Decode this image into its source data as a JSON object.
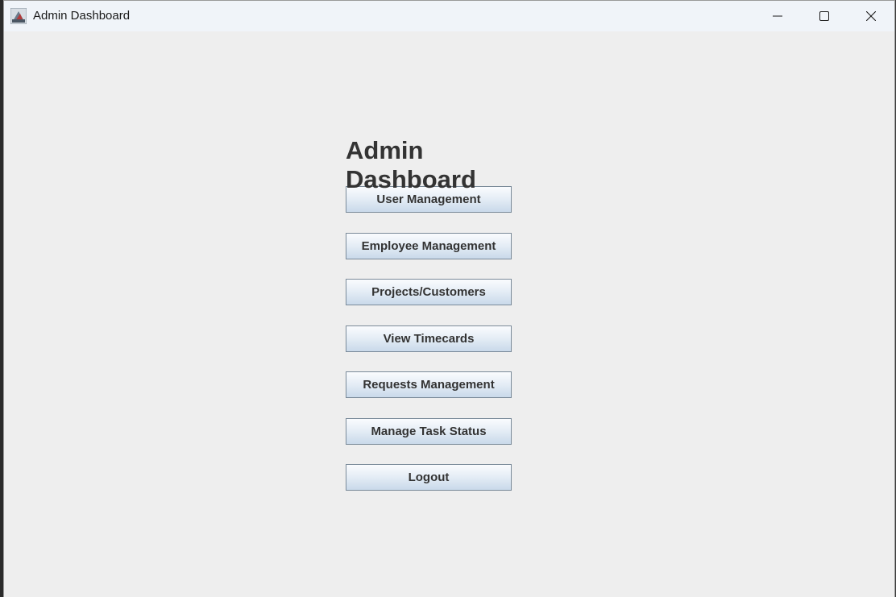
{
  "window": {
    "title": "Admin Dashboard",
    "app_icon": "java-app-icon"
  },
  "window_controls": {
    "minimize_icon": "minimize-icon",
    "maximize_icon": "maximize-icon",
    "close_icon": "close-icon"
  },
  "main": {
    "heading": "Admin Dashboard",
    "buttons": [
      {
        "label": "User Management"
      },
      {
        "label": "Employee Management"
      },
      {
        "label": "Projects/Customers"
      },
      {
        "label": "View Timecards"
      },
      {
        "label": "Requests Management"
      },
      {
        "label": "Manage Task Status"
      },
      {
        "label": "Logout"
      }
    ]
  },
  "colors": {
    "content_background": "#eeeeee",
    "titlebar_background": "#f0f4f9",
    "button_border": "#7a8a99",
    "text": "#333333"
  }
}
